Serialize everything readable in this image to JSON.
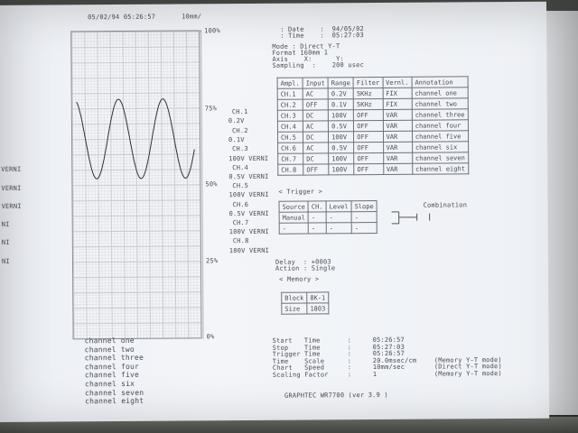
{
  "header": {
    "datetime": "05/02/94 05:26:57",
    "rate": "10mm/"
  },
  "scale": {
    "p100": "100%",
    "p75": "75%",
    "p50": "50%",
    "p25": "25%",
    "p0": "0%"
  },
  "info": {
    "date": ": Date    :  94/05/02",
    "time": ": Time    :  05:27:03",
    "mode": "Mode : Direct Y-T",
    "format": "Format 160mm 1",
    "axis": "Axis    X:      Y:",
    "sampling": "Sampling  :    200 usec"
  },
  "channel_list": [
    "CH.1",
    "0.2V",
    "CH.2",
    "0.1V",
    "CH.3",
    "100V VERNI",
    "CH.4",
    "0.5V VERNI",
    "CH.5",
    "100V VERNI",
    "CH.6",
    "0.5V VERNI",
    "CH.7",
    "100V VERNI",
    "CH.8",
    "100V VERNI"
  ],
  "left_edge": [
    "VERNI",
    "VERNI",
    "VERNI",
    "NI",
    "NI",
    "NI"
  ],
  "channel_table": {
    "headers": [
      "Ampl.",
      "Input",
      "Range",
      "Filter",
      "Vernl.",
      "Annotation"
    ],
    "rows": [
      [
        "CH.1",
        "AC",
        "0.2V",
        "5KHz",
        "FIX",
        "channel one"
      ],
      [
        "CH.2",
        "OFF",
        "0.1V",
        "5KHz",
        "FIX",
        "channel two"
      ],
      [
        "CH.3",
        "DC",
        "100V",
        "OFF",
        "VAR",
        "channel three"
      ],
      [
        "CH.4",
        "AC",
        "0.5V",
        "OFF",
        "VAR",
        "channel four"
      ],
      [
        "CH.5",
        "DC",
        "100V",
        "OFF",
        "VAR",
        "channel five"
      ],
      [
        "CH.6",
        "AC",
        "0.5V",
        "OFF",
        "VAR",
        "channel six"
      ],
      [
        "CH.7",
        "DC",
        "100V",
        "OFF",
        "VAR",
        "channel seven"
      ],
      [
        "CH.8",
        "OFF",
        "100V",
        "OFF",
        "VAR",
        "channel eight"
      ]
    ]
  },
  "trigger": {
    "title": "< Trigger >",
    "headers": [
      "Source",
      "CH.",
      "Level",
      "Slope"
    ],
    "rows": [
      [
        "Manual",
        "-",
        "-",
        "-"
      ],
      [
        "-",
        "-",
        "-",
        "-"
      ]
    ],
    "combination": "Combination"
  },
  "delay": {
    "delay": "Delay  : +0003",
    "action": "Action : Single"
  },
  "memory": {
    "title": "< Memory >",
    "rows": [
      [
        "Block",
        "8K-1"
      ],
      [
        "Size",
        "1803"
      ]
    ]
  },
  "times": [
    [
      "Start   Time",
      ":",
      "05:26:57",
      ""
    ],
    [
      "Stop    Time",
      ":",
      "05:27:03",
      ""
    ],
    [
      "Trigger Time",
      ":",
      "05:26:57",
      ""
    ],
    [
      "Time    Scale",
      ":",
      "20.0msec/cm",
      "(Memory Y-T mode)"
    ],
    [
      "Chart   Speed",
      ":",
      "10mm/sec",
      "(Direct Y-T mode)"
    ],
    [
      "Scaling Factor",
      ":",
      "1",
      "(Memory Y-T mode)"
    ]
  ],
  "footer": "GRAPHTEC WR7700 (ver 3.9 )",
  "annotations": [
    "channel one",
    "channel two",
    "channel three",
    "channel four",
    "channel five",
    "channel six",
    "channel seven",
    "channel eight"
  ]
}
